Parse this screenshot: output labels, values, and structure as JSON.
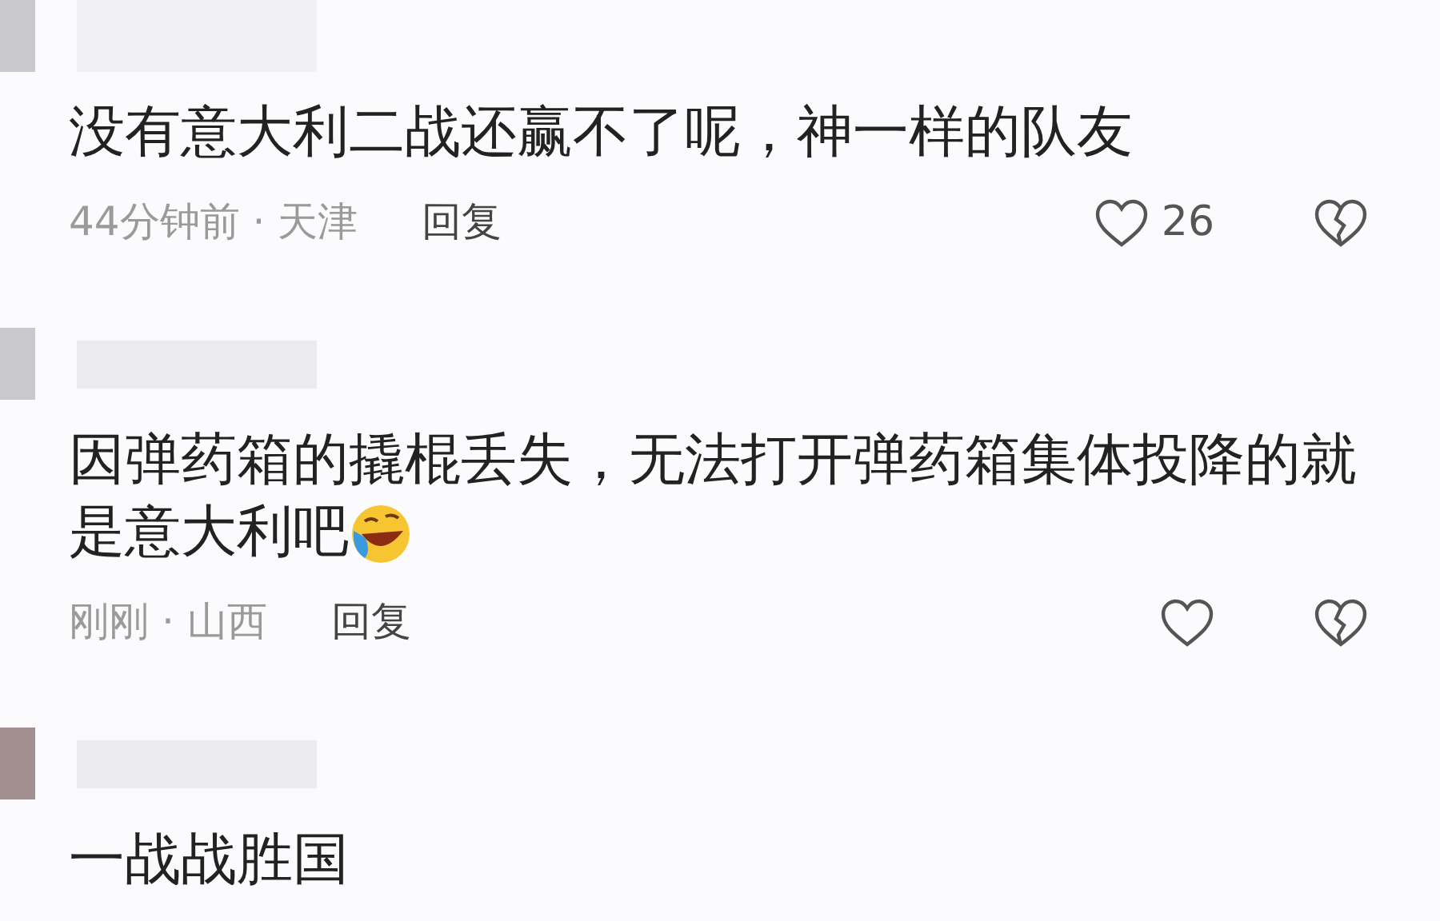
{
  "comments": [
    {
      "lines": [
        "没有意大利二战还赢不了呢，神一样的队友"
      ],
      "meta": "44分钟前 · 天津",
      "reply": "回复",
      "likes": "26"
    },
    {
      "lines": [
        "因弹药箱的撬棍丢失，无法打开弹药箱集体投降的就",
        "是意大利吧"
      ],
      "emoji": true,
      "meta": "刚刚 · 山西",
      "reply": "回复"
    },
    {
      "lines": [
        "一战战胜国"
      ]
    }
  ]
}
